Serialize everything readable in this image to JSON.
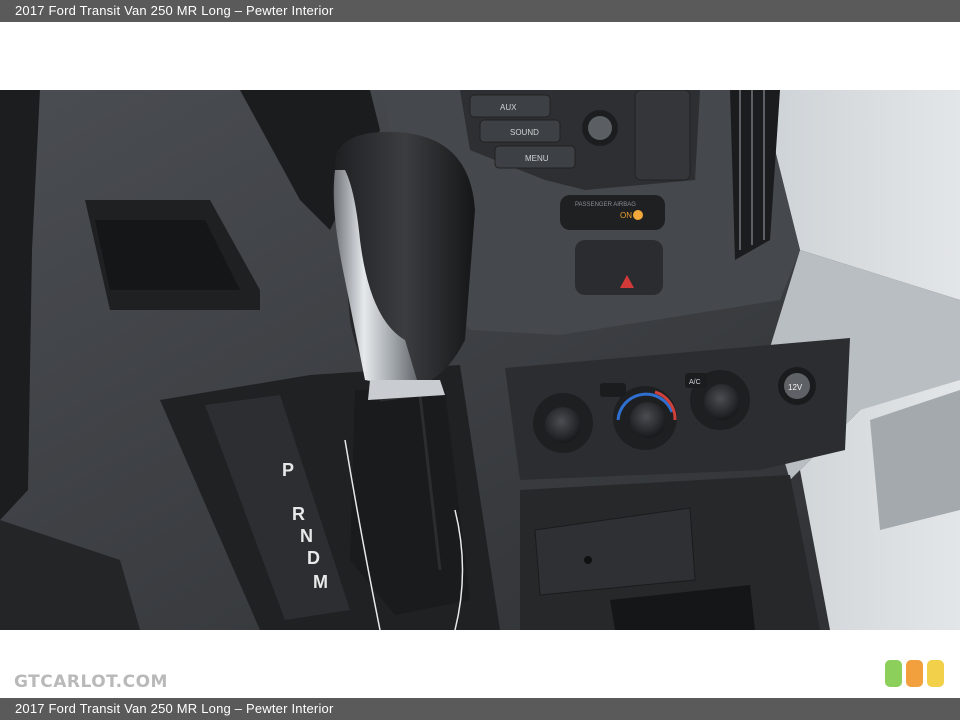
{
  "header": {
    "caption": "2017 Ford Transit Van 250 MR Long – Pewter Interior"
  },
  "footer": {
    "caption": "2017 Ford Transit Van 250 MR Long – Pewter Interior"
  },
  "watermark": {
    "text": "GTCARLOT.COM"
  },
  "photo": {
    "shift_pattern": [
      "P",
      "R",
      "N",
      "D",
      "M"
    ],
    "button_labels": {
      "aux": "AUX",
      "sound": "SOUND",
      "menu": "MENU",
      "ac": "A/C",
      "power_outlet": "12V",
      "airbag": "PASSENGER AIRBAG",
      "airbag_state": "ON"
    }
  },
  "colors": {
    "green_light": "#8ccf5a",
    "orange_light": "#f2a03d",
    "yellow_light": "#f2d04a",
    "bar": "#5a5a5a"
  }
}
